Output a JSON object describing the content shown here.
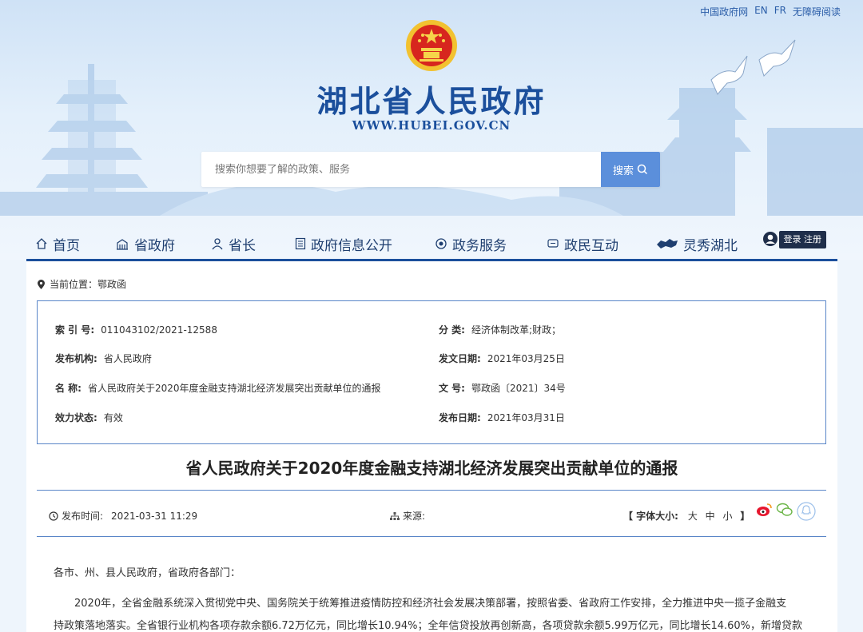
{
  "top_links": [
    "中国政府网",
    "EN",
    "FR",
    "无障碍阅读"
  ],
  "site": {
    "title": "湖北省人民政府",
    "url": "WWW.HUBEI.GOV.CN"
  },
  "search": {
    "placeholder": "搜索你想要了解的政策、服务",
    "button_label": "搜索"
  },
  "nav": {
    "items": [
      {
        "label": "首页",
        "icon": "home-icon"
      },
      {
        "label": "省政府",
        "icon": "building-icon"
      },
      {
        "label": "省长",
        "icon": "person-icon"
      },
      {
        "label": "政府信息公开",
        "icon": "document-icon"
      },
      {
        "label": "政务服务",
        "icon": "service-icon"
      },
      {
        "label": "政民互动",
        "icon": "chat-icon"
      },
      {
        "label": "灵秀湖北",
        "icon": "hubei-map-icon"
      }
    ],
    "login_label": "登录 注册"
  },
  "breadcrumb": {
    "prefix": "当前位置：",
    "current": "鄂政函"
  },
  "info": {
    "index_label": "索 引 号:",
    "index_value": "011043102/2021-12588",
    "category_label": "分 类:",
    "category_value": "经济体制改革;财政；",
    "issuer_label": "发布机构:",
    "issuer_value": "省人民政府",
    "doc_date_label": "发文日期:",
    "doc_date_value": "2021年03月25日",
    "name_label": "名 称:",
    "name_value": "省人民政府关于2020年度金融支持湖北经济发展突出贡献单位的通报",
    "doc_no_label": "文 号:",
    "doc_no_value": "鄂政函〔2021〕34号",
    "status_label": "效力状态:",
    "status_value": "有效",
    "pub_date_label": "发布日期:",
    "pub_date_value": "2021年03月31日"
  },
  "article": {
    "title": "省人民政府关于2020年度金融支持湖北经济发展突出贡献单位的通报",
    "publish_time_label": "发布时间:",
    "publish_time": "2021-03-31 11:29",
    "source_label": "来源:",
    "font_size_open": "【 字体大小:",
    "font_large": "大",
    "font_medium": "中",
    "font_small": "小",
    "font_size_close": "】",
    "salutation": "各市、州、县人民政府，省政府各部门：",
    "para1_line1": "2020年，全省金融系统深入贯彻党中央、国务院关于统筹推进疫情防控和经济社会发展决策部署，按照省委、省政府工作安排，全力推进中央一揽子金融支",
    "para1_line2": "持政策落地落实。全省银行业机构各项存款余额6.72万亿元，同比增长10.94%；全年信贷投放再创新高，各项贷款余额5.99万亿元，同比增长14.60%，新增贷款"
  },
  "colors": {
    "brand_blue": "#1b4f9c",
    "search_button": "#5b8fdb",
    "border_blue": "#5a86c8"
  }
}
